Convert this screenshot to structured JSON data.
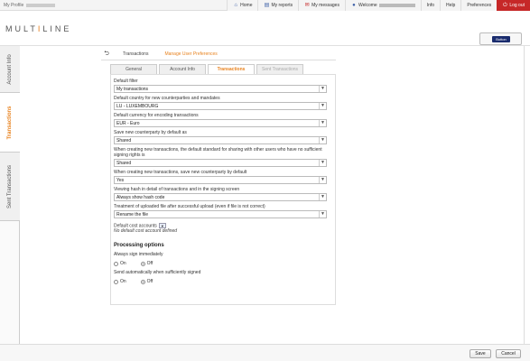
{
  "topbar": {
    "profile_label": "My Profile",
    "nav": [
      {
        "icon": "home-icon",
        "label": "Home"
      },
      {
        "icon": "reports-icon",
        "label": "My reports"
      },
      {
        "icon": "messages-icon",
        "label": "My messages"
      },
      {
        "icon": "welcome-icon",
        "label": "Welcome"
      },
      {
        "icon": "",
        "label": "Info"
      },
      {
        "icon": "",
        "label": "Help"
      },
      {
        "icon": "",
        "label": "Preferences"
      },
      {
        "icon": "logout-icon",
        "label": "Log out"
      }
    ]
  },
  "logo": {
    "part1": "MULT",
    "accent": "I",
    "part2": "LINE"
  },
  "header_button": {
    "label": "Button"
  },
  "sidebar": {
    "items": [
      {
        "label": "Account Info",
        "active": false
      },
      {
        "label": "Transactions",
        "active": true
      },
      {
        "label": "Sent Transactions",
        "active": false
      }
    ]
  },
  "breadcrumb": {
    "items": [
      "Transactions",
      "Manage User Preferences"
    ]
  },
  "tabs": [
    {
      "label": "General",
      "state": "normal"
    },
    {
      "label": "Account Info",
      "state": "normal"
    },
    {
      "label": "Transactions",
      "state": "active"
    },
    {
      "label": "Sent Transactions",
      "state": "disabled"
    }
  ],
  "form": {
    "fields": [
      {
        "label": "Default filter",
        "value": "My transactions"
      },
      {
        "label": "Default country for new counterparties and mandates",
        "value": "LU - LUXEMBOURG"
      },
      {
        "label": "Default currency for encoding transactions",
        "value": "EUR - Euro"
      },
      {
        "label": "Save new counterparty by default as",
        "value": "Shared"
      },
      {
        "label": "When creating new transactions, the default standard for sharing with other users who have no sufficient signing rights is",
        "value": "Shared"
      },
      {
        "label": "When creating new transactions, save new counterparty by default",
        "value": "Yes"
      },
      {
        "label": "Viewing hash in detail of transactions and in the signing screen",
        "value": "Always show hash code"
      },
      {
        "label": "Treatment of uploaded file after successful upload (even if file is not correct)",
        "value": "Rename the file"
      }
    ],
    "cost_accounts_label": "Default cost accounts",
    "cost_accounts_value": "No default cost account defined",
    "processing_title": "Processing options",
    "always_sign_label": "Always sign immediately",
    "send_auto_label": "Send automatically when sufficiently signed",
    "on_label": "On",
    "off_label": "Off",
    "always_sign_value": "Off",
    "send_auto_value": "Off"
  },
  "footer": {
    "save_label": "Save",
    "cancel_label": "Cancel"
  },
  "colors": {
    "accent": "#e8821e",
    "logout": "#c62828",
    "brand_button": "#1a2c6e"
  }
}
